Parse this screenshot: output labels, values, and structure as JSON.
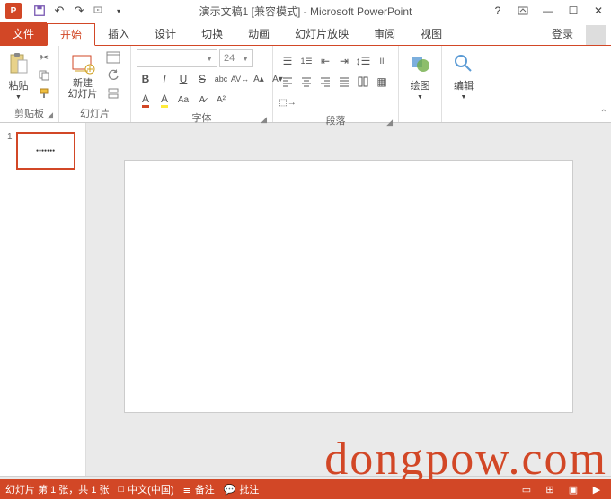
{
  "title": "演示文稿1 [兼容模式] - Microsoft PowerPoint",
  "qat": {
    "save": "save-icon",
    "undo": "undo-icon",
    "redo": "redo-icon",
    "start": "start-icon"
  },
  "tabs": {
    "file": "文件",
    "items": [
      {
        "id": "home",
        "label": "开始",
        "active": true
      },
      {
        "id": "insert",
        "label": "插入"
      },
      {
        "id": "design",
        "label": "设计"
      },
      {
        "id": "transitions",
        "label": "切换"
      },
      {
        "id": "animations",
        "label": "动画"
      },
      {
        "id": "slideshow",
        "label": "幻灯片放映"
      },
      {
        "id": "review",
        "label": "审阅"
      },
      {
        "id": "view",
        "label": "视图"
      }
    ],
    "login": "登录"
  },
  "ribbon": {
    "clipboard": {
      "label": "剪贴板",
      "paste": "粘贴"
    },
    "slides": {
      "label": "幻灯片",
      "newslide": "新建\n幻灯片"
    },
    "font": {
      "label": "字体",
      "family": "",
      "size": "24"
    },
    "paragraph": {
      "label": "段落"
    },
    "drawing": {
      "label": "绘图",
      "btn": "绘图"
    },
    "editing": {
      "label": "编辑",
      "btn": "编辑"
    }
  },
  "status": {
    "slideinfo": "幻灯片 第 1 张，共 1 张",
    "lang": "中文(中国)",
    "notes": "备注",
    "comments": "批注"
  },
  "thumb": {
    "num": "1",
    "text": "●●●●●●●"
  },
  "watermark": "dongpow.com"
}
